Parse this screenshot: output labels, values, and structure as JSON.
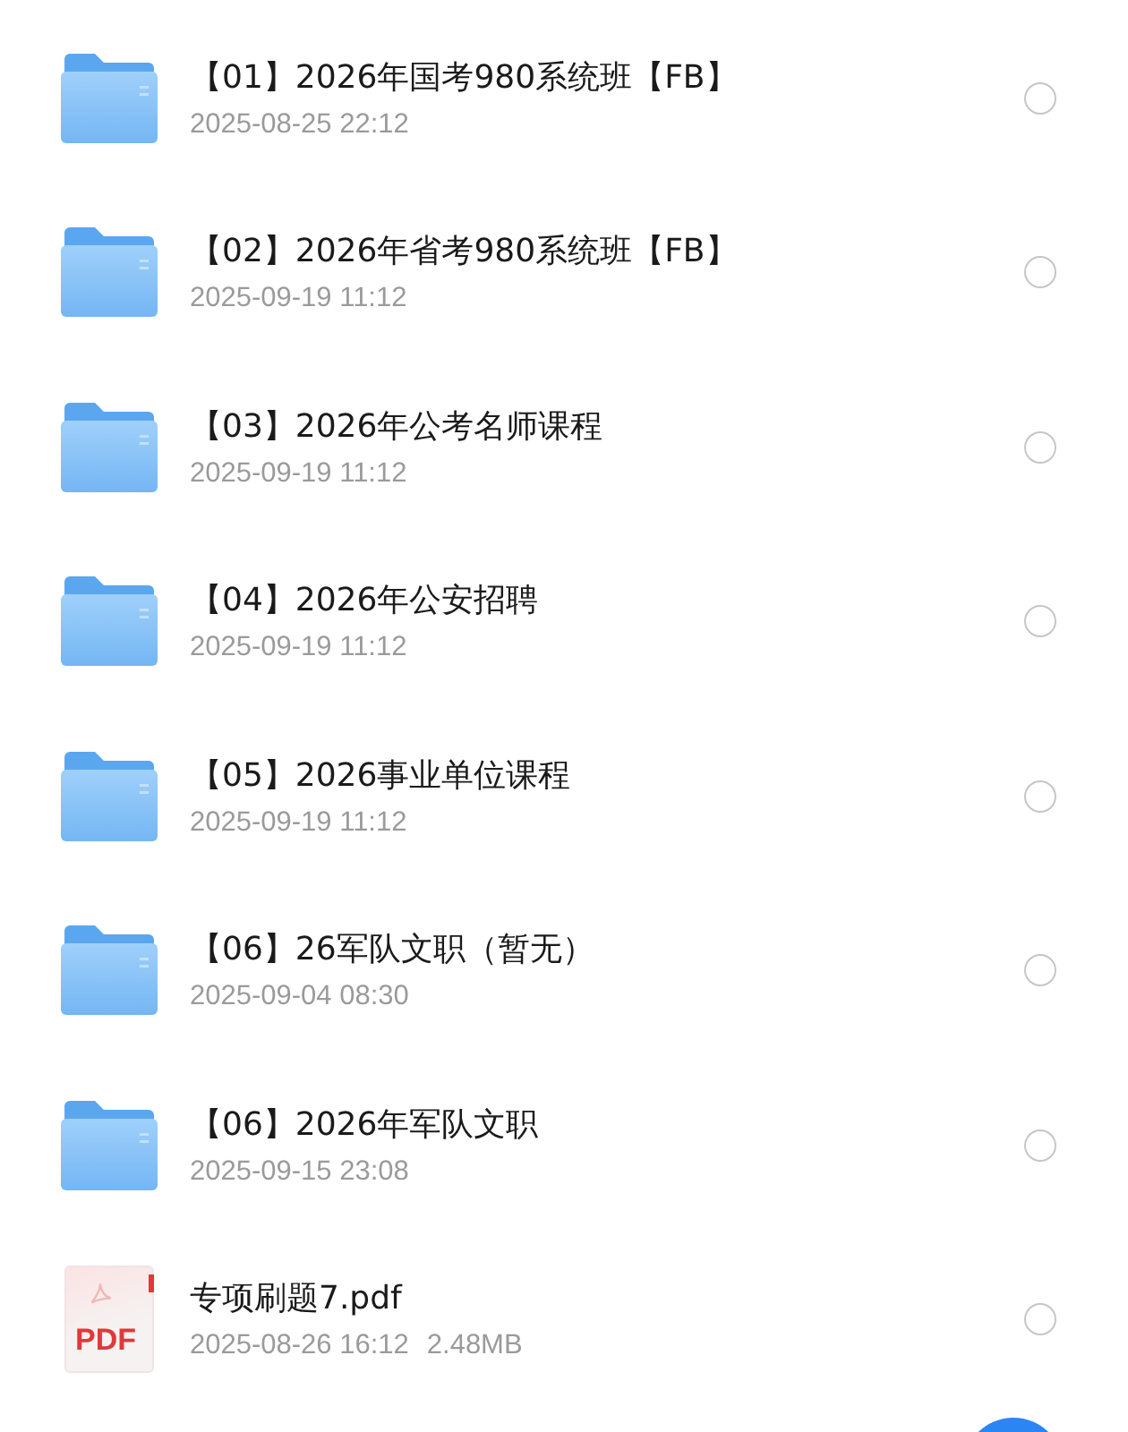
{
  "files": [
    {
      "kind": "folder",
      "name": "【01】2026年国考980系统班【FB】",
      "date": "2025-08-25 22:12",
      "selected": false
    },
    {
      "kind": "folder",
      "name": "【02】2026年省考980系统班【FB】",
      "date": "2025-09-19 11:12",
      "selected": false
    },
    {
      "kind": "folder",
      "name": "【03】2026年公考名师课程",
      "date": "2025-09-19 11:12",
      "selected": false
    },
    {
      "kind": "folder",
      "name": "【04】2026年公安招聘",
      "date": "2025-09-19 11:12",
      "selected": false
    },
    {
      "kind": "folder",
      "name": "【05】2026事业单位课程",
      "date": "2025-09-19 11:12",
      "selected": false
    },
    {
      "kind": "folder",
      "name": "【06】26军队文职（暂无）",
      "date": "2025-09-04 08:30",
      "selected": false
    },
    {
      "kind": "folder",
      "name": "【06】2026年军队文职",
      "date": "2025-09-15 23:08",
      "selected": false
    },
    {
      "kind": "pdf",
      "icon_label": "PDF",
      "name": "专项刷题7.pdf",
      "date": "2025-08-26 16:12",
      "size": "2.48MB",
      "selected": false
    }
  ]
}
